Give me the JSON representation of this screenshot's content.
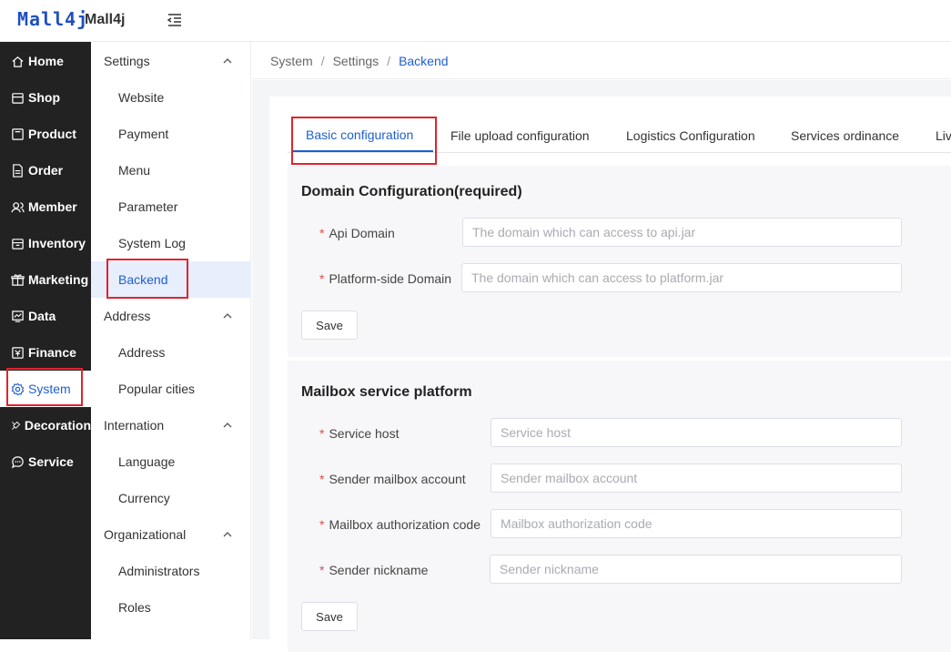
{
  "header": {
    "logo_text": "Mall4j",
    "brand": "Mall4j"
  },
  "nav": {
    "items": [
      {
        "label": "Home",
        "icon": "home-icon"
      },
      {
        "label": "Shop",
        "icon": "shop-icon"
      },
      {
        "label": "Product",
        "icon": "product-icon"
      },
      {
        "label": "Order",
        "icon": "order-icon"
      },
      {
        "label": "Member",
        "icon": "member-icon"
      },
      {
        "label": "Inventory",
        "icon": "inventory-icon"
      },
      {
        "label": "Marketing",
        "icon": "gift-icon"
      },
      {
        "label": "Data",
        "icon": "chart-icon"
      },
      {
        "label": "Finance",
        "icon": "finance-icon"
      },
      {
        "label": "System",
        "icon": "gear-icon"
      },
      {
        "label": "Decoration",
        "icon": "decoration-icon"
      },
      {
        "label": "Service",
        "icon": "chat-icon"
      }
    ],
    "active": "System"
  },
  "submenu": {
    "settings": "Settings",
    "website": "Website",
    "payment": "Payment",
    "menu": "Menu",
    "parameter": "Parameter",
    "system_log": "System Log",
    "backend": "Backend",
    "address_group": "Address",
    "address": "Address",
    "popular_cities": "Popular cities",
    "internation": "Internation",
    "language": "Language",
    "currency": "Currency",
    "organizational": "Organizational",
    "administrators": "Administrators",
    "roles": "Roles"
  },
  "breadcrumb": {
    "a": "System",
    "b": "Settings",
    "c": "Backend",
    "sep": "/"
  },
  "tabs": {
    "basic": "Basic configuration",
    "file_upload": "File upload configuration",
    "logistics": "Logistics Configuration",
    "services": "Services ordinance",
    "live": "Live"
  },
  "domain": {
    "title": "Domain Configuration(required)",
    "api_label": "Api Domain",
    "api_placeholder": "The domain which can access to api.jar",
    "platform_label": "Platform-side Domain",
    "platform_placeholder": "The domain which can access to platform.jar",
    "save": "Save"
  },
  "mailbox": {
    "title": "Mailbox service platform",
    "host_label": "Service host",
    "host_placeholder": "Service host",
    "account_label": "Sender mailbox account",
    "account_placeholder": "Sender mailbox account",
    "code_label": "Mailbox authorization code",
    "code_placeholder": "Mailbox authorization code",
    "nick_label": "Sender nickname",
    "nick_placeholder": "Sender nickname",
    "save": "Save"
  },
  "required_mark": "*",
  "colors": {
    "primary": "#1f5fd1",
    "sidebar": "#222222",
    "highlight": "#e0242c",
    "required": "#e54848"
  }
}
